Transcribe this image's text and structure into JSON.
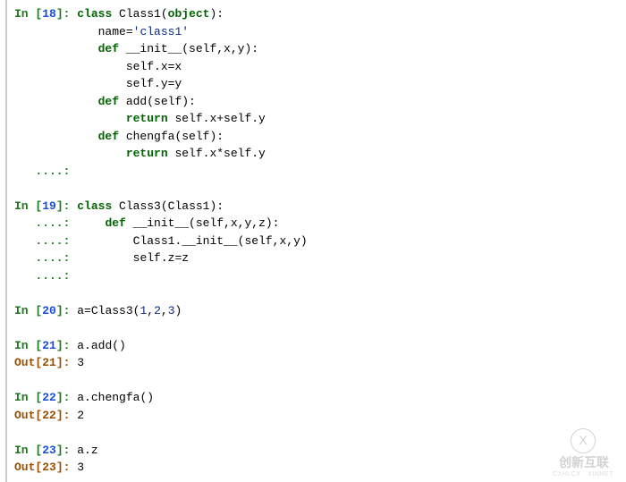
{
  "prompts": {
    "in": "In [",
    "out": "Out[",
    "close": "]: ",
    "cont": "   ....: "
  },
  "cells": [
    {
      "n": "18",
      "in": [
        {
          "pre": "",
          "tokens": [
            [
              "kw",
              "class"
            ],
            [
              "plain",
              " Class1("
            ],
            [
              "kw",
              "object"
            ],
            [
              "plain",
              "):"
            ]
          ]
        },
        {
          "pre": "    ",
          "tokens": [
            [
              "plain",
              "name="
            ],
            [
              "str",
              "'class1'"
            ]
          ]
        },
        {
          "pre": "    ",
          "tokens": [
            [
              "kw",
              "def"
            ],
            [
              "plain",
              " __init__(self,x,y):"
            ]
          ]
        },
        {
          "pre": "        ",
          "tokens": [
            [
              "plain",
              "self.x=x"
            ]
          ]
        },
        {
          "pre": "        ",
          "tokens": [
            [
              "plain",
              "self.y=y"
            ]
          ]
        },
        {
          "pre": "    ",
          "tokens": [
            [
              "kw",
              "def"
            ],
            [
              "plain",
              " add(self):"
            ]
          ]
        },
        {
          "pre": "        ",
          "tokens": [
            [
              "kw",
              "return"
            ],
            [
              "plain",
              " self.x+self.y"
            ]
          ]
        },
        {
          "pre": "    ",
          "tokens": [
            [
              "kw",
              "def"
            ],
            [
              "plain",
              " chengfa(self):"
            ]
          ]
        },
        {
          "pre": "        ",
          "tokens": [
            [
              "kw",
              "return"
            ],
            [
              "plain",
              " self.x*self.y"
            ]
          ]
        }
      ],
      "cont_extra": 1,
      "blank_after": 1
    },
    {
      "n": "19",
      "in": [
        {
          "pre": "",
          "tokens": [
            [
              "kw",
              "class"
            ],
            [
              "plain",
              " Class3(Class1):"
            ]
          ]
        }
      ],
      "cont_lines": [
        {
          "pre": "    ",
          "tokens": [
            [
              "kw",
              "def"
            ],
            [
              "plain",
              " __init__(self,x,y,z):"
            ]
          ]
        },
        {
          "pre": "        ",
          "tokens": [
            [
              "plain",
              "Class1.__init__(self,x,y)"
            ]
          ]
        },
        {
          "pre": "        ",
          "tokens": [
            [
              "plain",
              "self.z=z"
            ]
          ]
        }
      ],
      "cont_extra": 1,
      "blank_after": 1
    },
    {
      "n": "20",
      "in": [
        {
          "pre": "",
          "tokens": [
            [
              "plain",
              "a=Class3("
            ],
            [
              "str",
              "1"
            ],
            [
              "plain",
              ","
            ],
            [
              "str",
              "2"
            ],
            [
              "plain",
              ","
            ],
            [
              "str",
              "3"
            ],
            [
              "plain",
              ")"
            ]
          ]
        }
      ],
      "blank_after": 1
    },
    {
      "n": "21",
      "in": [
        {
          "pre": "",
          "tokens": [
            [
              "plain",
              "a.add()"
            ]
          ]
        }
      ],
      "out": "3",
      "blank_after": 1
    },
    {
      "n": "22",
      "in": [
        {
          "pre": "",
          "tokens": [
            [
              "plain",
              "a.chengfa()"
            ]
          ]
        }
      ],
      "out": "2",
      "blank_after": 1
    },
    {
      "n": "23",
      "in": [
        {
          "pre": "",
          "tokens": [
            [
              "plain",
              "a.z"
            ]
          ]
        }
      ],
      "out": "3"
    }
  ],
  "watermark": {
    "circle": "X",
    "main": "创新互联",
    "sub": "CXHLCX · XINNET"
  }
}
